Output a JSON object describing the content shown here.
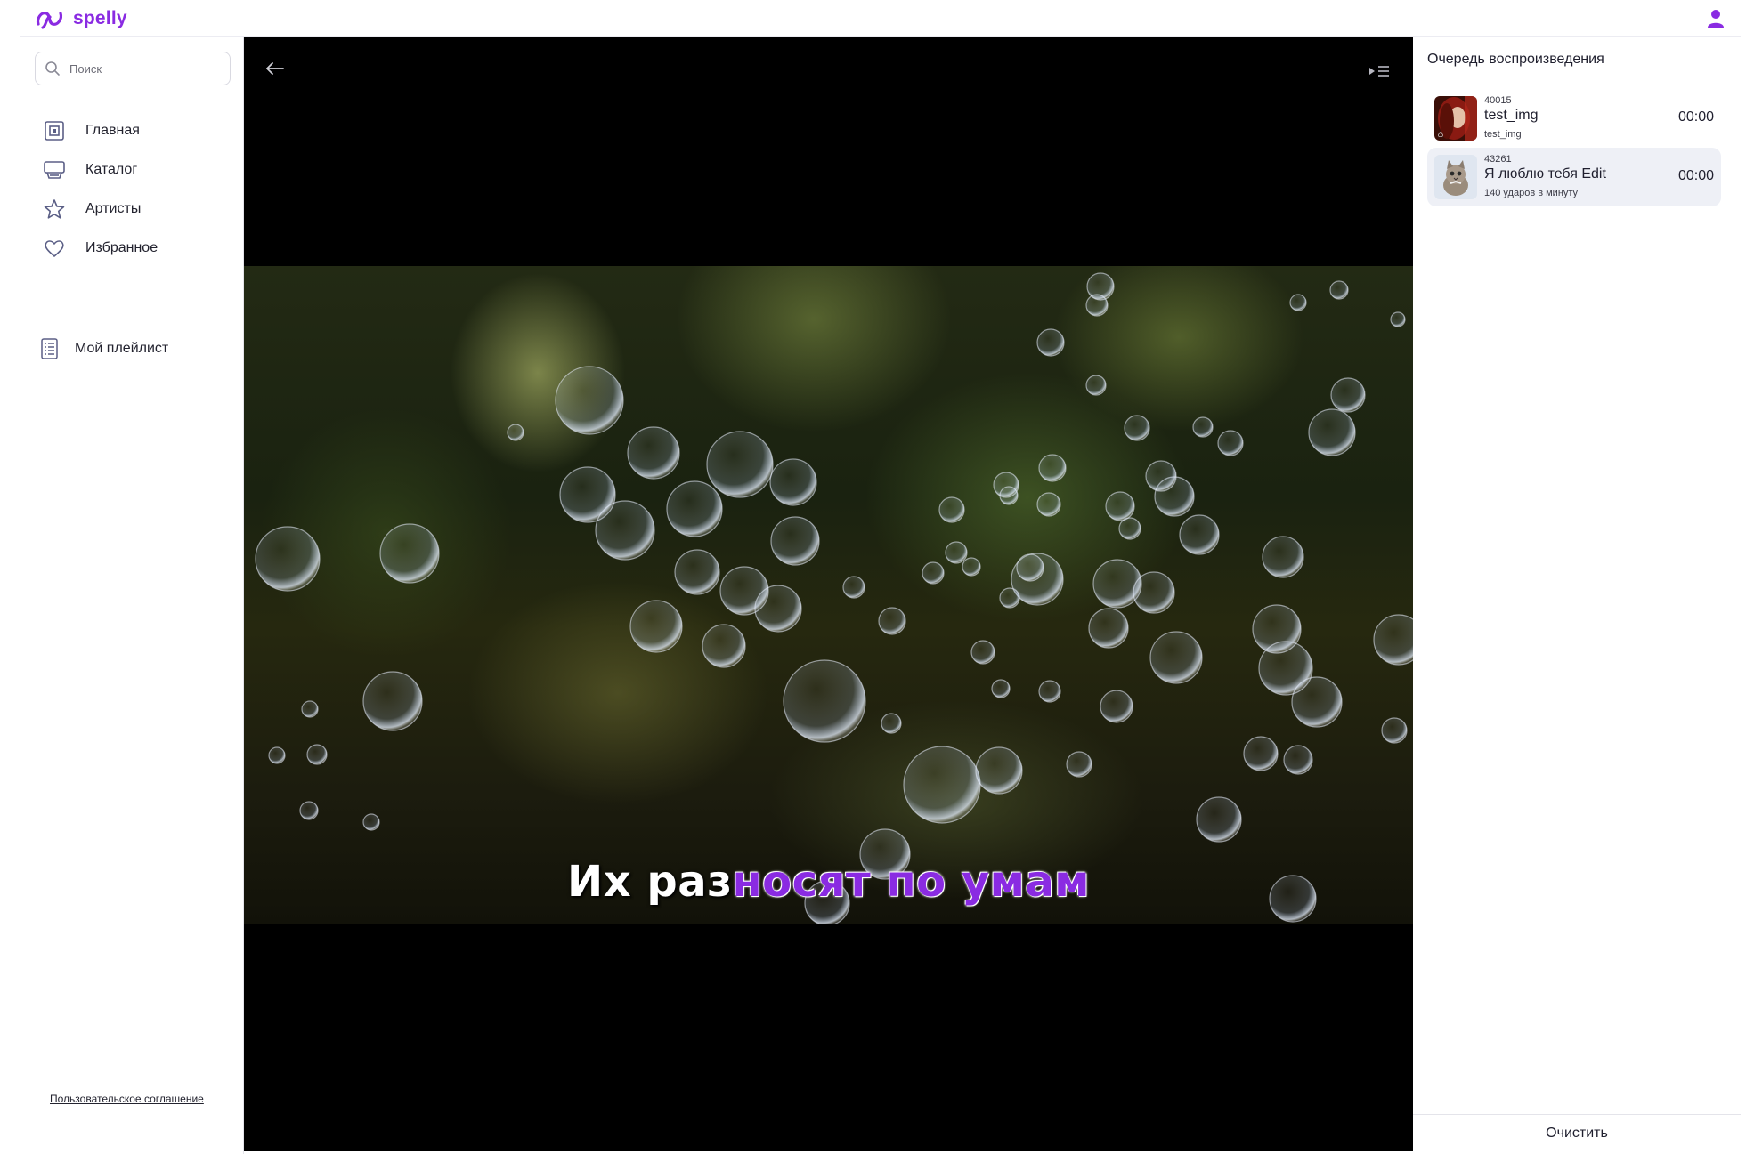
{
  "app": {
    "name": "spelly"
  },
  "colors": {
    "accent": "#8a2be2",
    "icon_nav": "#5b5f86"
  },
  "search": {
    "placeholder": "Поиск",
    "value": ""
  },
  "sidebar": {
    "items": [
      {
        "label": "Главная",
        "icon": "home-icon"
      },
      {
        "label": "Каталог",
        "icon": "catalog-icon"
      },
      {
        "label": "Артисты",
        "icon": "star-icon"
      },
      {
        "label": "Избранное",
        "icon": "heart-icon"
      }
    ],
    "playlist": {
      "label": "Мой плейлист",
      "icon": "playlist-icon"
    },
    "terms_link": "Пользовательское соглашение"
  },
  "player": {
    "lyric_sung": "Их раз",
    "lyric_unsung": "носят по умам"
  },
  "queue": {
    "title": "Очередь воспроизведения",
    "tracks": [
      {
        "id": "40015",
        "title": "test_img",
        "subtitle": "test_img",
        "duration": "00:00"
      },
      {
        "id": "43261",
        "title": "Я люблю тебя Edit",
        "subtitle": "140 ударов в минуту",
        "duration": "00:00"
      }
    ],
    "clear_label": "Очистить"
  }
}
